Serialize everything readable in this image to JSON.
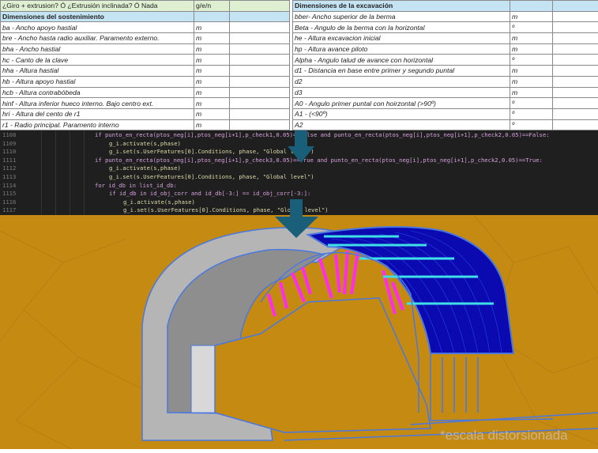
{
  "left_table": {
    "question": "¿Giro + extrusion? Ó ¿Extrusión inclinada? Ó Nada",
    "question_unit": "g/e/n",
    "header": "Dimensiones del sostenimiento",
    "rows": [
      {
        "label": "ba - Ancho apoyo hastial",
        "unit": "m"
      },
      {
        "label": "bre - Ancho hasta radio auxiliar. Paramento externo.",
        "unit": "m"
      },
      {
        "label": "bha - Ancho hastial",
        "unit": "m"
      },
      {
        "label": "hc - Canto de la clave",
        "unit": "m"
      },
      {
        "label": "hha - Altura hastial",
        "unit": "m"
      },
      {
        "label": "hb - Altura apoyo hastial",
        "unit": "m"
      },
      {
        "label": "hcb - Altura contrabóbeda",
        "unit": "m"
      },
      {
        "label": "hinf - Altura inferior hueco interno. Bajo centro ext.",
        "unit": "m"
      },
      {
        "label": "hri - Altura del cento de r1",
        "unit": "m"
      },
      {
        "label": "r1 - Radio principal. Paramento interno",
        "unit": "m"
      }
    ]
  },
  "right_table": {
    "header": "Dimensiones de la excavación",
    "rows": [
      {
        "label": "bber- Ancho superior de la berma",
        "unit": "m"
      },
      {
        "label": "Beta - Angulo de la berma con la horizontal",
        "unit": "º"
      },
      {
        "label": "he - Altura excavacion inicial",
        "unit": "m"
      },
      {
        "label": "hp - Altura avance piloto",
        "unit": "m"
      },
      {
        "label": "Alpha - Angulo talud de avance con horizontal",
        "unit": "º"
      },
      {
        "label": "d1 - Distancia en base entre primer y segundo puntal",
        "unit": "m"
      },
      {
        "label": "d2",
        "unit": "m"
      },
      {
        "label": "d3",
        "unit": "m"
      },
      {
        "label": "A0 - Angulo primer puntal con hoirzontal (>90º)",
        "unit": "º"
      },
      {
        "label": "A1 - (<90º)",
        "unit": "º"
      },
      {
        "label": "A2",
        "unit": "º"
      }
    ]
  },
  "code": [
    {
      "n": "1108",
      "indent": 4,
      "text": "if punto_en_recta(ptos_neg[i],ptos_neg[i+1],p_check1,0.05)==False and punto_en_recta(ptos_neg[i],ptos_neg[i+1],p_check2,0.05)==False:"
    },
    {
      "n": "1109",
      "indent": 5,
      "text": "g_i.activate(s,phase)"
    },
    {
      "n": "1110",
      "indent": 5,
      "text": "g_i.set(s.UserFeatures[0].Conditions, phase, \"Global level\")"
    },
    {
      "n": "1111",
      "indent": 4,
      "text": "if punto_en_recta(ptos_neg[i],ptos_neg[i+1],p_check3,0.05)==True and punto_en_recta(ptos_neg[i],ptos_neg[i+1],p_check2,0.05)==True:"
    },
    {
      "n": "1112",
      "indent": 5,
      "text": "g_i.activate(s,phase)"
    },
    {
      "n": "1113",
      "indent": 5,
      "text": "g_i.set(s.UserFeatures[0].Conditions, phase, \"Global level\")"
    },
    {
      "n": "1114",
      "indent": 4,
      "text": "for id_db in list_id_db:"
    },
    {
      "n": "1115",
      "indent": 5,
      "text": "if id_db in id_obj_corr and id_db[-3:] == id_obj_corr[-3:]:"
    },
    {
      "n": "1116",
      "indent": 6,
      "text": "g_i.activate(s,phase)"
    },
    {
      "n": "1117",
      "indent": 6,
      "text": "g_i.set(s.UserFeatures[0].Conditions, phase, \"Global level\")"
    }
  ],
  "render": {
    "note": "*escala distorsionada",
    "colors": {
      "soil": "#c48a12",
      "lining": "#b4b4b4",
      "steel": "#0a0ab0",
      "bolts": "#ff2cf0",
      "beams": "#40e0e8",
      "edges": "#4a78e0",
      "arrow": "#1a5f7a"
    }
  }
}
